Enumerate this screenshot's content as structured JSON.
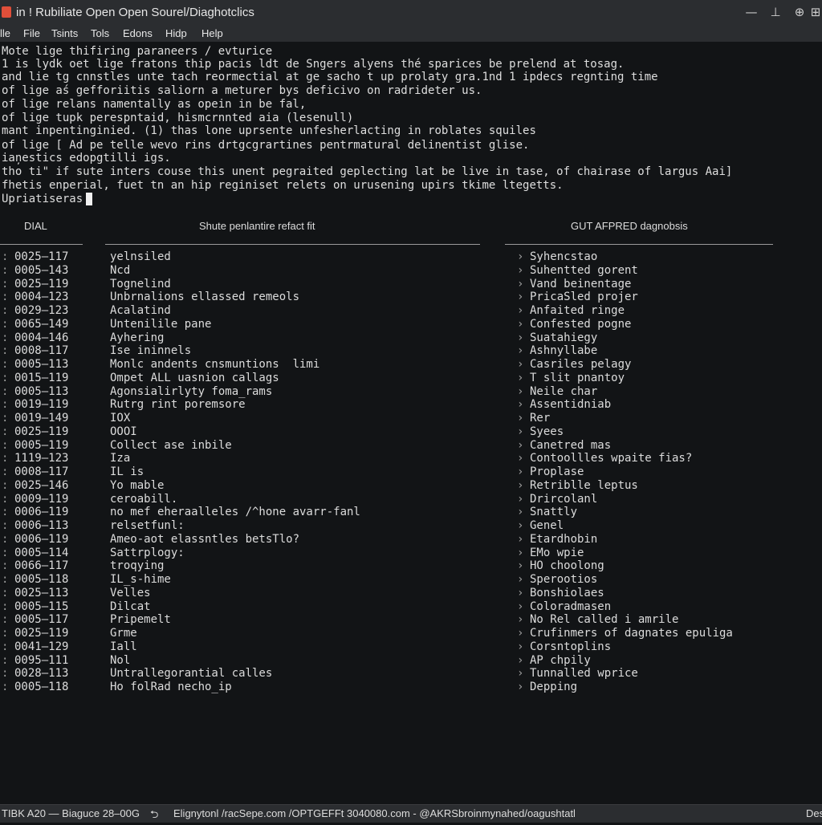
{
  "window": {
    "title": "in ! Rubiliate Open Open Sourel/Diaghotclics",
    "controls": [
      "—",
      "⊥",
      "⊕",
      "⊞"
    ]
  },
  "menu": {
    "items": [
      "lle",
      "File",
      "Tsints",
      "Tols",
      "Edons",
      "Hidp",
      "Help"
    ]
  },
  "terminal": {
    "lines": [
      "Mote lige thifiring paraneers / evturice",
      "1 is lydk oet lige fratons thip pacis ldt de Sngers alyens thé sparices be prelend at tosag.",
      "and lie tg cnnstles unte tach reormectial at ge sacho t up prolaty gra.1nd 1 ipdecs regnting time",
      "of lige aś gefforiitis saliorn a meturer bys deficivo on radrideter us.",
      "of lige relans namentally as opein in be fal,",
      "of lige tupk perespntaid, hismcrnnted aia (lesenull)",
      "mant inpentinginied. (1) thas lone uprsente unfesherlacting in roblates squiles",
      "of lige [ Ad pe telle wevo rins drtgcgrartines pentrmatural delinentist glise.",
      "iaņestics edopgtilli igs.",
      "tho ti\" if sute inters couse this unent pegraited geplecting lat be live in tase, of chairase of largus Aai]",
      "fhetis enperial, fuet tn an hip reginiset relets on urusening upirs tkime ltegetts.",
      "Upriatiseras"
    ]
  },
  "columns": {
    "left_header": "DIAL",
    "middle_header": "Shute penlantire refact fit",
    "right_header": "GUT AFPRED dagnobsis",
    "rows": [
      {
        "code": "0025–117",
        "desc": "yelnsiled",
        "diag": "Syhencstao"
      },
      {
        "code": "0005–143",
        "desc": "Ncd",
        "diag": "Suhentted gorent"
      },
      {
        "code": "0025–119",
        "desc": "Tognelind",
        "diag": "Vand beinentage"
      },
      {
        "code": "0004–123",
        "desc": "Unbrnalions ellassed remeols",
        "diag": "PricaSled projer"
      },
      {
        "code": "0029–123",
        "desc": "Acalatind",
        "diag": "Anfaited ringe"
      },
      {
        "code": "0065–149",
        "desc": "Untenilile pane",
        "diag": "Confested pogne"
      },
      {
        "code": "0004–146",
        "desc": "Ayhering",
        "diag": "Suatahiegy"
      },
      {
        "code": "0008–117",
        "desc": "Ise ininnels",
        "diag": "Ashnyllabe"
      },
      {
        "code": "0005–113",
        "desc": "Monlc andents cnsmuntions  limi",
        "diag": "Casriles pelagy"
      },
      {
        "code": "0015–119",
        "desc": "Ompet ALL uasnion callags",
        "diag": "T slit pnantoy"
      },
      {
        "code": "0005–113",
        "desc": "Agonsialirlyty foma_rams",
        "diag": "Neile char"
      },
      {
        "code": "0019–119",
        "desc": "Rutrg rint poremsore",
        "diag": "Assentidniab"
      },
      {
        "code": "0019–149",
        "desc": "IOX",
        "diag": "Rer"
      },
      {
        "code": "0025–119",
        "desc": "OOOI",
        "diag": "Syees"
      },
      {
        "code": "0005–119",
        "desc": "Collect ase inbile",
        "diag": "Canetred mas"
      },
      {
        "code": "1119–123",
        "desc": "Iza",
        "diag": "Contoollles wpaite fias?"
      },
      {
        "code": "0008–117",
        "desc": "IL is",
        "diag": "Proplase"
      },
      {
        "code": "0025–146",
        "desc": "Yo mable",
        "diag": "Retriblle leptus"
      },
      {
        "code": "0009–119",
        "desc": "ceroabill.",
        "diag": "Drircolanl"
      },
      {
        "code": "0006–119",
        "desc": "no mef eheraalleles /^hone avarr-fanl",
        "diag": "Snattly"
      },
      {
        "code": "0006–113",
        "desc": "relsetfunl:",
        "diag": "Genel"
      },
      {
        "code": "0006–119",
        "desc": "Ameo-aot elassntles betsTlo?",
        "diag": "Etardhobin"
      },
      {
        "code": "0005–114",
        "desc": "Sattrplogy:",
        "diag": "EMo wpie"
      },
      {
        "code": "0066–117",
        "desc": "troqying",
        "diag": "HO choolong"
      },
      {
        "code": "0005–118",
        "desc": "IL_s-hime",
        "diag": "Sperootios"
      },
      {
        "code": "0025–113",
        "desc": "Velles",
        "diag": "Bonshiolaes"
      },
      {
        "code": "0005–115",
        "desc": "Dilcat",
        "diag": "Coloradmasen"
      },
      {
        "code": "0005–117",
        "desc": "Pripemelt",
        "diag": "No Rel called i amrile"
      },
      {
        "code": "0025–119",
        "desc": "Grme",
        "diag": "Crufinmers of dagnates epuliga"
      },
      {
        "code": "0041–129",
        "desc": "Iall",
        "diag": "Corsntoplins"
      },
      {
        "code": "0095–111",
        "desc": "Nol",
        "diag": "AP chpily"
      },
      {
        "code": "0028–113",
        "desc": "Untrallegorantial calles",
        "diag": "Tunnalled wprice"
      },
      {
        "code": "0005–118",
        "desc": "Ho folRad necho_ip",
        "diag": "Depping"
      }
    ]
  },
  "status": {
    "left": "TIBK A20 — Biaguce 28–00G",
    "icon": "⮌",
    "right": "Elignytonl /racSepe.com /OPTGEFFt 3040080.com - @AKRSbroinmynahed/oagushtatl",
    "far_right": "Des"
  }
}
